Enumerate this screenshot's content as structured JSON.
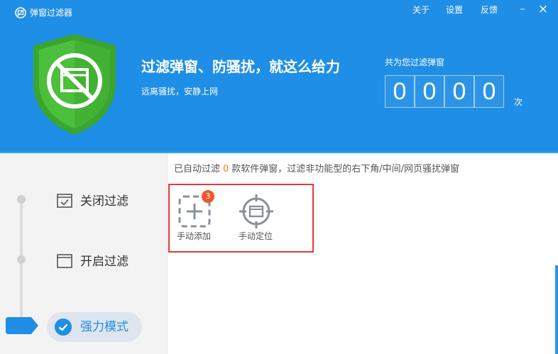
{
  "window": {
    "title": "弹窗过滤器",
    "menu": [
      "关于",
      "设置",
      "反馈"
    ],
    "minimize": "–",
    "close": "×"
  },
  "hero": {
    "headline": "过滤弹窗、防骚扰，就这么给力",
    "subline": "远离骚扰，安静上网"
  },
  "counter": {
    "label": "共为您过滤弹窗",
    "digits": [
      "0",
      "0",
      "0",
      "0"
    ],
    "unit": "次"
  },
  "sidebar": {
    "items": [
      {
        "label": "关闭过滤",
        "icon": "checked-window-icon"
      },
      {
        "label": "开启过滤",
        "icon": "window-icon"
      },
      {
        "label": "强力模式",
        "icon": "check-circle-icon",
        "active": true
      }
    ]
  },
  "info": {
    "prefix": "已自动过滤",
    "count": "0",
    "suffix": "款软件弹窗，过滤非功能型的右下角/中间/网页骚扰弹窗"
  },
  "tools": {
    "manual_add": {
      "label": "手动添加",
      "badge": "3",
      "icon": "dashed-plus-icon"
    },
    "manual_locate": {
      "label": "手动定位",
      "icon": "crosshair-window-icon"
    }
  },
  "colors": {
    "header_blue": "#1f8ee6",
    "shield_green": "#4cbf3c",
    "badge_orange": "#f2552c",
    "count_orange": "#ff7a1a",
    "highlight_red": "#e23b3b"
  }
}
